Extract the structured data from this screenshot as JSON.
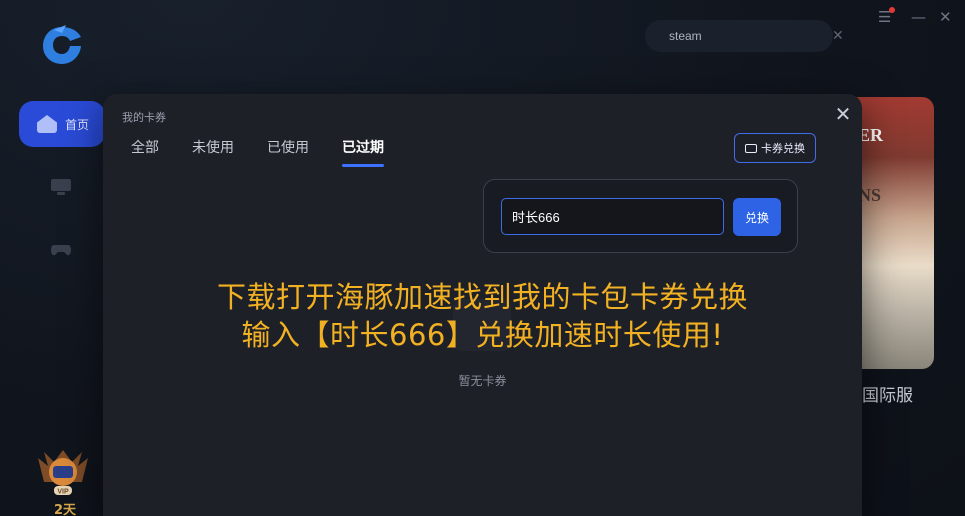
{
  "search": {
    "value": "steam"
  },
  "sidebar": {
    "home_label": "首页",
    "vip_days": "2天"
  },
  "game_card": {
    "title": "国际服",
    "art_text_1": "ER",
    "art_text_2": "NS"
  },
  "modal": {
    "title": "我的卡券",
    "tabs": [
      {
        "label": "全部"
      },
      {
        "label": "未使用"
      },
      {
        "label": "已使用"
      },
      {
        "label": "已过期"
      }
    ],
    "redeem_button": "卡券兑换",
    "popover": {
      "code_value": "时长666",
      "exchange_label": "兑换"
    },
    "overlay_line_1": "下载打开海豚加速找到我的卡包卡券兑换",
    "overlay_line_2": "输入【时长666】兑换加速时长使用!",
    "empty_text": "暂无卡券"
  },
  "colors": {
    "accent": "#2e63e6",
    "promo": "#f2b122",
    "modal_bg": "#1e2028"
  }
}
